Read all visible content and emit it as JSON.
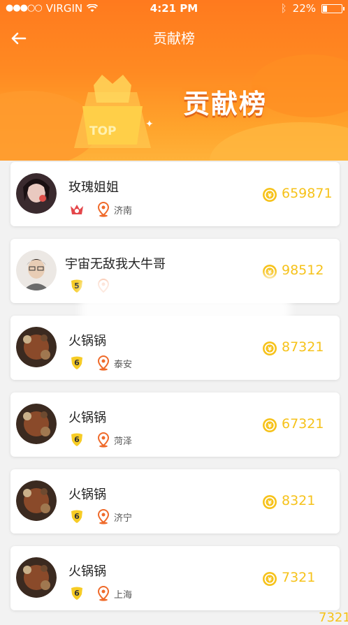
{
  "status_bar": {
    "carrier": "VIRGIN",
    "time": "4:21 PM",
    "battery": "22%"
  },
  "nav": {
    "title": "贡献榜"
  },
  "banner": {
    "title": "贡献榜",
    "top_label": "TOP"
  },
  "colors": {
    "header_orange": "#ff7a1e",
    "score_gold": "#f6c21a",
    "pin_orange": "#ef6a2a"
  },
  "ranking": [
    {
      "name": "玫瑰姐姐",
      "level": "",
      "city": "济南",
      "score": "659871",
      "badge": "crown"
    },
    {
      "name": "宇宙无敌我大牛哥",
      "level": "5",
      "city": "",
      "score": "98512",
      "badge": "shield"
    },
    {
      "name": "火锅锅",
      "level": "6",
      "city": "泰安",
      "score": "87321",
      "badge": "shield"
    },
    {
      "name": "火锅锅",
      "level": "6",
      "city": "菏泽",
      "score": "67321",
      "badge": "shield"
    },
    {
      "name": "火锅锅",
      "level": "6",
      "city": "济宁",
      "score": "8321",
      "badge": "shield"
    },
    {
      "name": "火锅锅",
      "level": "6",
      "city": "上海",
      "score": "7321",
      "badge": "shield"
    }
  ],
  "peek": {
    "score": "7321"
  }
}
